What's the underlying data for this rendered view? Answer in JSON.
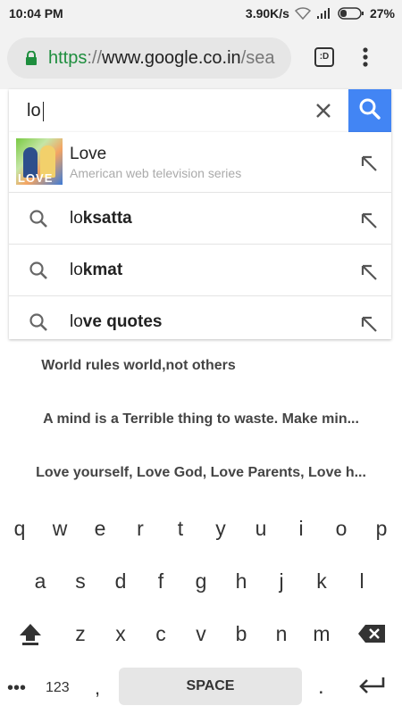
{
  "status_bar": {
    "time": "10:04 PM",
    "network_speed": "3.90K/s",
    "battery": "27%"
  },
  "browser": {
    "url_scheme": "https",
    "url_sep": "://",
    "url_host": "www.google.co.in",
    "url_path": "/sea",
    "tab_count": ":D"
  },
  "search": {
    "query": "lo"
  },
  "suggestions": [
    {
      "title": "Love",
      "subtitle": "American web television series",
      "thumb_text": "LOVE"
    },
    {
      "prefix": "lo",
      "suffix": "ksatta"
    },
    {
      "prefix": "lo",
      "suffix": "kmat"
    },
    {
      "prefix": "lo",
      "suffix": "ve quotes"
    }
  ],
  "page": {
    "quotes": [
      "World rules world,not others",
      "A mind is a Terrible thing to waste. Make min...",
      "Love yourself, Love God, Love Parents, Love h..."
    ]
  },
  "keyboard": {
    "row1": [
      "q",
      "w",
      "e",
      "r",
      "t",
      "y",
      "u",
      "i",
      "o",
      "p"
    ],
    "row2": [
      "a",
      "s",
      "d",
      "f",
      "g",
      "h",
      "j",
      "k",
      "l"
    ],
    "row3": [
      "z",
      "x",
      "c",
      "v",
      "b",
      "n",
      "m"
    ],
    "symbols_label": "123",
    "dots_label": "•••",
    "comma": ",",
    "space_label": "SPACE",
    "period": "."
  },
  "colors": {
    "accent": "#4285f4",
    "secure": "#1e8e3e"
  },
  "icons": [
    "lock-icon",
    "clear-icon",
    "search-icon",
    "arrow-up-left-icon",
    "shift-icon",
    "backspace-icon",
    "enter-icon",
    "menu-icon",
    "wifi-icon",
    "signal-icon",
    "battery-icon"
  ]
}
